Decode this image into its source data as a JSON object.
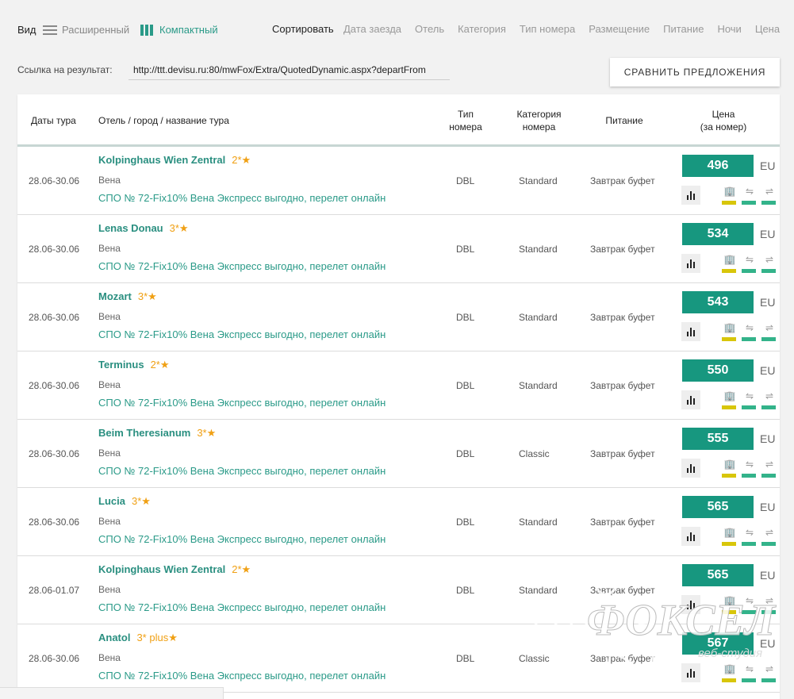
{
  "toolbar": {
    "view_label": "Вид",
    "view_extended": "Расширенный",
    "view_compact": "Компактный",
    "sort_label": "Сортировать",
    "sort_options": [
      "Дата заезда",
      "Отель",
      "Категория",
      "Тип номера",
      "Размещение",
      "Питание",
      "Ночи",
      "Цена"
    ]
  },
  "link": {
    "label": "Ссылка на результат:",
    "value": "http://ttt.devisu.ru:80/mwFox/Extra/QuotedDynamic.aspx?departFrom"
  },
  "compare_button": "СРАВНИТЬ ПРЕДЛОЖЕНИЯ",
  "table": {
    "headers": {
      "dates": "Даты тура",
      "hotel": "Отель / город / название тура",
      "room_type_1": "Тип",
      "room_type_2": "номера",
      "room_cat_1": "Категория",
      "room_cat_2": "номера",
      "meal": "Питание",
      "price_1": "Цена",
      "price_2": "(за номер)"
    },
    "rows": [
      {
        "dates": "28.06-30.06",
        "hotel": "Kolpinghaus Wien Zentral",
        "stars": "2*★",
        "city": "Вена",
        "tour": "СПО № 72-Fix10% Вена Экспресс выгодно, перелет онлайн",
        "room": "DBL",
        "category": "Standard",
        "meal": "Завтрак буфет",
        "price": "496",
        "currency": "EU"
      },
      {
        "dates": "28.06-30.06",
        "hotel": "Lenas Donau",
        "stars": "3*★",
        "city": "Вена",
        "tour": "СПО № 72-Fix10% Вена Экспресс выгодно, перелет онлайн",
        "room": "DBL",
        "category": "Standard",
        "meal": "Завтрак буфет",
        "price": "534",
        "currency": "EU"
      },
      {
        "dates": "28.06-30.06",
        "hotel": "Mozart",
        "stars": "3*★",
        "city": "Вена",
        "tour": "СПО № 72-Fix10% Вена Экспресс выгодно, перелет онлайн",
        "room": "DBL",
        "category": "Standard",
        "meal": "Завтрак буфет",
        "price": "543",
        "currency": "EU"
      },
      {
        "dates": "28.06-30.06",
        "hotel": "Terminus",
        "stars": "2*★",
        "city": "Вена",
        "tour": "СПО № 72-Fix10% Вена Экспресс выгодно, перелет онлайн",
        "room": "DBL",
        "category": "Standard",
        "meal": "Завтрак буфет",
        "price": "550",
        "currency": "EU"
      },
      {
        "dates": "28.06-30.06",
        "hotel": "Beim Theresianum",
        "stars": "3*★",
        "city": "Вена",
        "tour": "СПО № 72-Fix10% Вена Экспресс выгодно, перелет онлайн",
        "room": "DBL",
        "category": "Classic",
        "meal": "Завтрак буфет",
        "price": "555",
        "currency": "EU"
      },
      {
        "dates": "28.06-30.06",
        "hotel": "Lucia",
        "stars": "3*★",
        "city": "Вена",
        "tour": "СПО № 72-Fix10% Вена Экспресс выгодно, перелет онлайн",
        "room": "DBL",
        "category": "Standard",
        "meal": "Завтрак буфет",
        "price": "565",
        "currency": "EU"
      },
      {
        "dates": "28.06-01.07",
        "hotel": "Kolpinghaus Wien Zentral",
        "stars": "2*★",
        "city": "Вена",
        "tour": "СПО № 72-Fix10% Вена Экспресс выгодно, перелет онлайн",
        "room": "DBL",
        "category": "Standard",
        "meal": "Завтрак буфет",
        "price": "565",
        "currency": "EU"
      },
      {
        "dates": "28.06-30.06",
        "hotel": "Anatol",
        "stars": "3* plus★",
        "city": "Вена",
        "tour": "СПО № 72-Fix10% Вена Экспресс выгодно, перелет онлайн",
        "room": "DBL",
        "category": "Classic",
        "meal": "Завтрак буфет",
        "price": "567",
        "currency": "EU"
      }
    ]
  },
  "watermark": {
    "brand": "ФОКСЕЛ",
    "sub": "веб-студия"
  },
  "icons": {
    "view_extended": "list-lines-icon",
    "view_compact": "columns-icon",
    "chart": "bar-chart-icon",
    "hotel": "hotel-icon",
    "transfer_to": "arrow-right-icon",
    "transfer_back": "arrow-left-icon"
  },
  "colors": {
    "accent": "#17977f",
    "link": "#2a9a88",
    "stars": "#f0a014",
    "yellow_bar": "#d8c60a",
    "green_bar": "#33b38a"
  }
}
